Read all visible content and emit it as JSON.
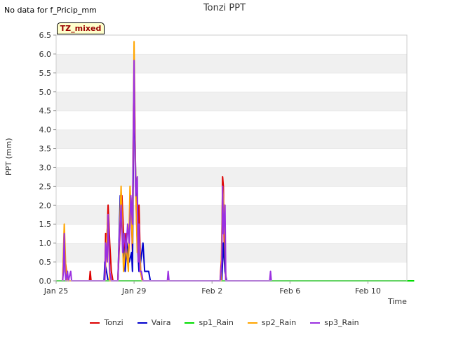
{
  "header": {
    "nodata_text": "No data for f_Pricip_mm",
    "badge_text": "TZ_mixed"
  },
  "chart_data": {
    "type": "line",
    "title": "Tonzi PPT",
    "xlabel": "Time",
    "ylabel": "PPT (mm)",
    "ylim": [
      0,
      6.5
    ],
    "xlim": [
      "2025-01-25",
      "2025-02-12"
    ],
    "yticks": [
      "0.0",
      "0.5",
      "1.0",
      "1.5",
      "2.0",
      "2.5",
      "3.0",
      "3.5",
      "4.0",
      "4.5",
      "5.0",
      "5.5",
      "6.0",
      "6.5"
    ],
    "xticks": [
      {
        "label": "Jan 25",
        "date": "2025-01-25"
      },
      {
        "label": "Jan 29",
        "date": "2025-01-29"
      },
      {
        "label": "Feb 2",
        "date": "2025-02-02"
      },
      {
        "label": "Feb 6",
        "date": "2025-02-06"
      },
      {
        "label": "Feb 10",
        "date": "2025-02-10"
      }
    ],
    "grid": "horizontal bands",
    "legend_position": "bottom",
    "series": [
      {
        "name": "Tonzi",
        "color": "#dd0000",
        "points": [
          [
            "2025-01-25T08:00",
            0
          ],
          [
            "2025-01-25T10:00",
            1.2
          ],
          [
            "2025-01-25T11:00",
            0.6
          ],
          [
            "2025-01-25T13:00",
            0.2
          ],
          [
            "2025-01-25T16:00",
            0
          ],
          [
            "2025-01-26T17:00",
            0
          ],
          [
            "2025-01-26T18:00",
            0.25
          ],
          [
            "2025-01-26T19:00",
            0
          ],
          [
            "2025-01-27T12:00",
            0
          ],
          [
            "2025-01-27T13:00",
            1.25
          ],
          [
            "2025-01-27T14:00",
            0.8
          ],
          [
            "2025-01-27T16:00",
            2.0
          ],
          [
            "2025-01-27T18:00",
            1.0
          ],
          [
            "2025-01-27T20:00",
            0.25
          ],
          [
            "2025-01-27T22:00",
            0
          ],
          [
            "2025-01-28T04:00",
            0
          ],
          [
            "2025-01-28T06:00",
            1.0
          ],
          [
            "2025-01-28T09:00",
            2.25
          ],
          [
            "2025-01-28T12:00",
            0.75
          ],
          [
            "2025-01-28T14:00",
            1.25
          ],
          [
            "2025-01-28T17:00",
            0.5
          ],
          [
            "2025-01-28T20:00",
            2.25
          ],
          [
            "2025-01-28T22:00",
            0.8
          ],
          [
            "2025-01-28T23:00",
            4.0
          ],
          [
            "2025-01-29T00:00",
            5.6
          ],
          [
            "2025-01-29T01:00",
            4.0
          ],
          [
            "2025-01-29T02:00",
            2.5
          ],
          [
            "2025-01-29T04:00",
            1.0
          ],
          [
            "2025-01-29T06:00",
            2.0
          ],
          [
            "2025-01-29T08:00",
            0.25
          ],
          [
            "2025-01-29T10:00",
            0
          ],
          [
            "2025-02-02T10:00",
            0
          ],
          [
            "2025-02-02T12:00",
            0.75
          ],
          [
            "2025-02-02T13:00",
            2.75
          ],
          [
            "2025-02-02T14:00",
            2.5
          ],
          [
            "2025-02-02T15:00",
            1.0
          ],
          [
            "2025-02-02T16:00",
            0.5
          ],
          [
            "2025-02-02T17:00",
            0
          ]
        ]
      },
      {
        "name": "Vaira",
        "color": "#0000cc",
        "points": [
          [
            "2025-01-27T11:00",
            0
          ],
          [
            "2025-01-27T12:00",
            0.5
          ],
          [
            "2025-01-27T14:00",
            0.25
          ],
          [
            "2025-01-27T16:00",
            0
          ],
          [
            "2025-01-28T04:00",
            0
          ],
          [
            "2025-01-28T07:00",
            2.25
          ],
          [
            "2025-01-28T10:00",
            1.25
          ],
          [
            "2025-01-28T13:00",
            0.25
          ],
          [
            "2025-01-28T15:00",
            1.0
          ],
          [
            "2025-01-28T18:00",
            0.5
          ],
          [
            "2025-01-28T21:00",
            0.75
          ],
          [
            "2025-01-28T22:00",
            0.25
          ],
          [
            "2025-01-29T00:00",
            5.3
          ],
          [
            "2025-01-29T02:00",
            2.75
          ],
          [
            "2025-01-29T04:00",
            1.0
          ],
          [
            "2025-01-29T06:00",
            0.25
          ],
          [
            "2025-01-29T08:00",
            0.5
          ],
          [
            "2025-01-29T11:00",
            1.0
          ],
          [
            "2025-01-29T13:00",
            0.25
          ],
          [
            "2025-01-29T15:00",
            0.25
          ],
          [
            "2025-01-29T18:00",
            0.25
          ],
          [
            "2025-01-29T20:00",
            0
          ],
          [
            "2025-02-02T12:00",
            0
          ],
          [
            "2025-02-02T14:00",
            1.0
          ],
          [
            "2025-02-02T16:00",
            0.25
          ],
          [
            "2025-02-02T18:00",
            0
          ]
        ]
      },
      {
        "name": "sp1_Rain",
        "color": "#00dd00",
        "points": [
          [
            "2025-01-25T00:00",
            0
          ],
          [
            "2025-02-12T09:00",
            0
          ]
        ]
      },
      {
        "name": "sp2_Rain",
        "color": "#ffa500",
        "points": [
          [
            "2025-01-25T08:00",
            0
          ],
          [
            "2025-01-25T10:00",
            1.5
          ],
          [
            "2025-01-25T12:00",
            0.25
          ],
          [
            "2025-01-25T14:00",
            0
          ],
          [
            "2025-01-27T12:00",
            0
          ],
          [
            "2025-01-27T14:00",
            1.0
          ],
          [
            "2025-01-27T16:00",
            1.75
          ],
          [
            "2025-01-27T18:00",
            0
          ],
          [
            "2025-01-28T04:00",
            0
          ],
          [
            "2025-01-28T08:00",
            2.5
          ],
          [
            "2025-01-28T11:00",
            0.25
          ],
          [
            "2025-01-28T14:00",
            1.0
          ],
          [
            "2025-01-28T17:00",
            0.25
          ],
          [
            "2025-01-28T19:00",
            2.5
          ],
          [
            "2025-01-28T22:00",
            1.0
          ],
          [
            "2025-01-29T00:00",
            6.33
          ],
          [
            "2025-01-29T02:00",
            2.5
          ],
          [
            "2025-01-29T04:00",
            0.75
          ],
          [
            "2025-01-29T06:00",
            1.25
          ],
          [
            "2025-01-29T08:00",
            0.25
          ],
          [
            "2025-01-29T10:00",
            0
          ],
          [
            "2025-02-02T11:00",
            0
          ],
          [
            "2025-02-02T13:00",
            2.5
          ],
          [
            "2025-02-02T15:00",
            1.75
          ],
          [
            "2025-02-02T17:00",
            0
          ]
        ]
      },
      {
        "name": "sp3_Rain",
        "color": "#9b30e0",
        "points": [
          [
            "2025-01-25T08:00",
            0
          ],
          [
            "2025-01-25T09:00",
            0.25
          ],
          [
            "2025-01-25T10:00",
            1.25
          ],
          [
            "2025-01-25T11:00",
            0.25
          ],
          [
            "2025-01-25T12:00",
            0
          ],
          [
            "2025-01-25T14:00",
            0.25
          ],
          [
            "2025-01-25T15:00",
            0
          ],
          [
            "2025-01-25T18:00",
            0.25
          ],
          [
            "2025-01-25T19:00",
            0
          ],
          [
            "2025-01-27T12:00",
            0
          ],
          [
            "2025-01-27T13:00",
            1.0
          ],
          [
            "2025-01-27T15:00",
            0.5
          ],
          [
            "2025-01-27T16:00",
            1.75
          ],
          [
            "2025-01-27T18:00",
            0.25
          ],
          [
            "2025-01-27T20:00",
            0
          ],
          [
            "2025-01-28T04:00",
            0
          ],
          [
            "2025-01-28T06:00",
            1.25
          ],
          [
            "2025-01-28T08:00",
            2.0
          ],
          [
            "2025-01-28T10:00",
            0.75
          ],
          [
            "2025-01-28T12:00",
            1.25
          ],
          [
            "2025-01-28T14:00",
            0.75
          ],
          [
            "2025-01-28T16:00",
            1.5
          ],
          [
            "2025-01-28T18:00",
            1.0
          ],
          [
            "2025-01-28T20:00",
            2.25
          ],
          [
            "2025-01-28T22:00",
            1.5
          ],
          [
            "2025-01-29T00:00",
            5.83
          ],
          [
            "2025-01-29T01:00",
            3.75
          ],
          [
            "2025-01-29T02:00",
            2.25
          ],
          [
            "2025-01-29T04:00",
            2.75
          ],
          [
            "2025-01-29T05:00",
            0.5
          ],
          [
            "2025-01-29T06:00",
            1.5
          ],
          [
            "2025-01-29T07:00",
            0.25
          ],
          [
            "2025-01-29T09:00",
            0.25
          ],
          [
            "2025-01-29T11:00",
            0
          ],
          [
            "2025-01-30T17:00",
            0
          ],
          [
            "2025-01-30T18:00",
            0.25
          ],
          [
            "2025-01-30T19:00",
            0
          ],
          [
            "2025-02-02T10:00",
            0
          ],
          [
            "2025-02-02T12:00",
            0.5
          ],
          [
            "2025-02-02T13:00",
            2.5
          ],
          [
            "2025-02-02T14:00",
            1.25
          ],
          [
            "2025-02-02T16:00",
            2.0
          ],
          [
            "2025-02-02T17:00",
            0
          ],
          [
            "2025-02-04T23:00",
            0
          ],
          [
            "2025-02-05T00:00",
            0.25
          ],
          [
            "2025-02-05T01:00",
            0
          ]
        ]
      }
    ]
  }
}
